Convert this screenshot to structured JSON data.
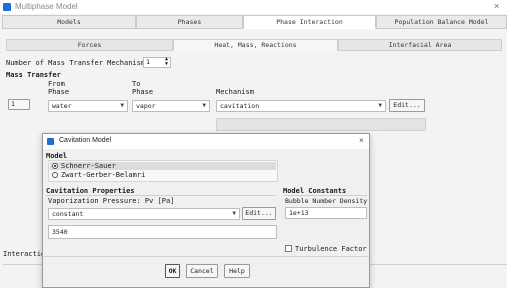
{
  "window": {
    "title": "Multiphase Model",
    "close": "×"
  },
  "tabs": [
    "Models",
    "Phases",
    "Phase Interaction",
    "Population Balance Model"
  ],
  "subtabs": [
    "Forces",
    "Heat, Mass, Reactions",
    "Interfacial Area"
  ],
  "mass_transfer": {
    "num_label": "Number of Mass Transfer Mechanisms",
    "num_value": "1",
    "section": "Mass Transfer",
    "col_from": "From",
    "col_from2": "Phase",
    "col_to": "To",
    "col_to2": "Phase",
    "col_mech": "Mechanism",
    "row_index": "1",
    "from_value": "water",
    "to_value": "vapor",
    "mechanism_value": "cavitation",
    "edit_label": "Edit..."
  },
  "interaction_label": "Interactio",
  "dialog": {
    "title": "Cavitation Model",
    "close": "×",
    "model_section": "Model",
    "model_options": [
      "Schnerr-Sauer",
      "Zwart-Gerber-Belamri"
    ],
    "selected_index": 0,
    "props_section": "Cavitation Properties",
    "vap_label": "Vaporization Pressure: Pv [Pa]",
    "vap_method": "constant",
    "edit_label": "Edit...",
    "vap_value": "3540",
    "constants_section": "Model Constants",
    "bubble_label": "Bubble Number Density",
    "bubble_value": "1e+13",
    "turbulence_label": "Turbulence Factor",
    "ok": "OK",
    "cancel": "Cancel",
    "help": "Help"
  },
  "colors": {
    "accent": "#1f6fd1",
    "selected_row": "#dcdcdc"
  }
}
